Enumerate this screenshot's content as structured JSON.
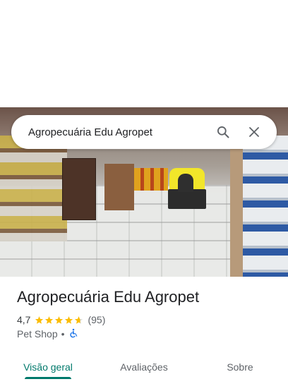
{
  "search": {
    "query": "Agropecuária Edu Agropet"
  },
  "icons": {
    "search": "search-icon",
    "close": "close-icon",
    "accessibility": "wheelchair-icon"
  },
  "place": {
    "name": "Agropecuária Edu Agropet",
    "rating": "4,7",
    "rating_value": 4.7,
    "review_count": "(95)",
    "category": "Pet Shop",
    "separator": "•"
  },
  "tabs": [
    {
      "label": "Visão geral",
      "active": true
    },
    {
      "label": "Avaliações",
      "active": false
    },
    {
      "label": "Sobre",
      "active": false
    }
  ],
  "colors": {
    "accent": "#00796b",
    "star": "#fbbc04",
    "accessibility": "#1a73e8"
  }
}
